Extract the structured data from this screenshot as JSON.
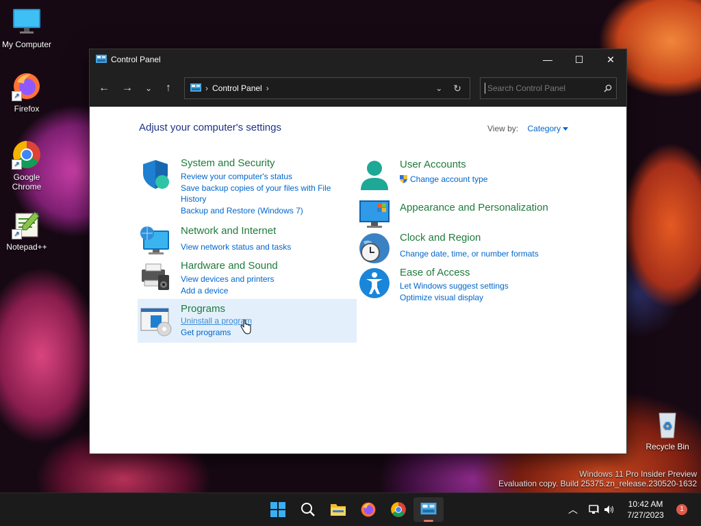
{
  "desktop": {
    "icons": [
      {
        "label": "My Computer"
      },
      {
        "label": "Firefox"
      },
      {
        "label": "Google Chrome"
      },
      {
        "label": "Notepad++"
      },
      {
        "label": "Recycle Bin"
      }
    ],
    "watermark": {
      "line1": "Windows 11 Pro Insider Preview",
      "line2": "Evaluation copy. Build 25375.zn_release.230520-1632"
    }
  },
  "window": {
    "title": "Control Panel",
    "address": {
      "crumb": "Control Panel"
    },
    "search": {
      "placeholder": "Search Control Panel"
    },
    "heading": "Adjust your computer's settings",
    "view_by": {
      "label": "View by:",
      "value": "Category"
    },
    "categories": [
      {
        "title": "System and Security",
        "links": [
          "Review your computer's status",
          "Save backup copies of your files with File History",
          "Backup and Restore (Windows 7)"
        ]
      },
      {
        "title": "Network and Internet",
        "links": [
          "View network status and tasks"
        ]
      },
      {
        "title": "Hardware and Sound",
        "links": [
          "View devices and printers",
          "Add a device"
        ]
      },
      {
        "title": "Programs",
        "links": [
          "Uninstall a program",
          "Get programs"
        ]
      },
      {
        "title": "User Accounts",
        "links": [
          "Change account type"
        ]
      },
      {
        "title": "Appearance and Personalization",
        "links": []
      },
      {
        "title": "Clock and Region",
        "links": [
          "Change date, time, or number formats"
        ]
      },
      {
        "title": "Ease of Access",
        "links": [
          "Let Windows suggest settings",
          "Optimize visual display"
        ]
      }
    ]
  },
  "taskbar": {
    "apps": [
      "start-icon",
      "search-icon",
      "file-explorer-icon",
      "firefox-icon",
      "chrome-icon",
      "control-panel-icon"
    ],
    "clock": {
      "time": "10:42 AM",
      "date": "7/27/2023"
    },
    "notification_count": "1"
  },
  "colors": {
    "title_bar": "#202020",
    "category_title": "#1e7a3c",
    "link": "#0066cc",
    "heading": "#1e3287",
    "highlight": "#e3f0fb"
  }
}
